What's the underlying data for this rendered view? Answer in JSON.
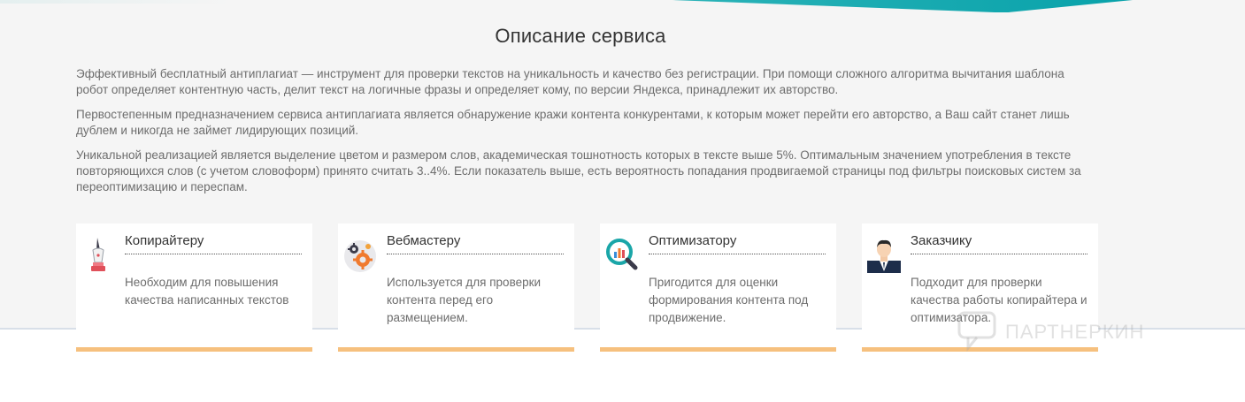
{
  "section": {
    "title": "Описание сервиса",
    "paragraphs": [
      "Эффективный бесплатный антиплагиат — инструмент для проверки текстов на уникальность и качество без регистрации. При помощи сложного алгоритма вычитания шаблона робот определяет контентную часть, делит текст на логичные фразы и определяет кому, по версии Яндекса, принадлежит их авторство.",
      "Первостепенным предназначением сервиса антиплагиата является обнаружение кражи контента конкурентами, к которым может перейти его авторство, а Ваш сайт станет лишь дублем и никогда не займет лидирующих позиций.",
      "Уникальной реализацией является выделение цветом и размером слов, академическая тошнотность которых в тексте выше 5%. Оптимальным значением употребления в тексте повторяющихся слов (с учетом словоформ) принято считать 3..4%. Если показатель выше, есть вероятность попадания продвигаемой страницы под фильтры поисковых систем за переоптимизацию и переспам."
    ]
  },
  "cards": [
    {
      "title": "Копирайтеру",
      "text": "Необходим для повышения качества написанных текстов",
      "icon": "pen-nib-icon"
    },
    {
      "title": "Вебмастеру",
      "text": "Используется для проверки контента перед его размещением.",
      "icon": "gears-icon"
    },
    {
      "title": "Оптимизатору",
      "text": "Пригодится для оценки формирования контента под продвижение.",
      "icon": "magnifier-chart-icon"
    },
    {
      "title": "Заказчику",
      "text": "Подходит для проверки качества работы копирайтера и оптимизатора.",
      "icon": "businessman-icon"
    }
  ],
  "watermark": {
    "text": "ПАРТНЕРКИН"
  },
  "colors": {
    "accent_bar": "#f6c07e",
    "teal": "#08a2aa"
  }
}
